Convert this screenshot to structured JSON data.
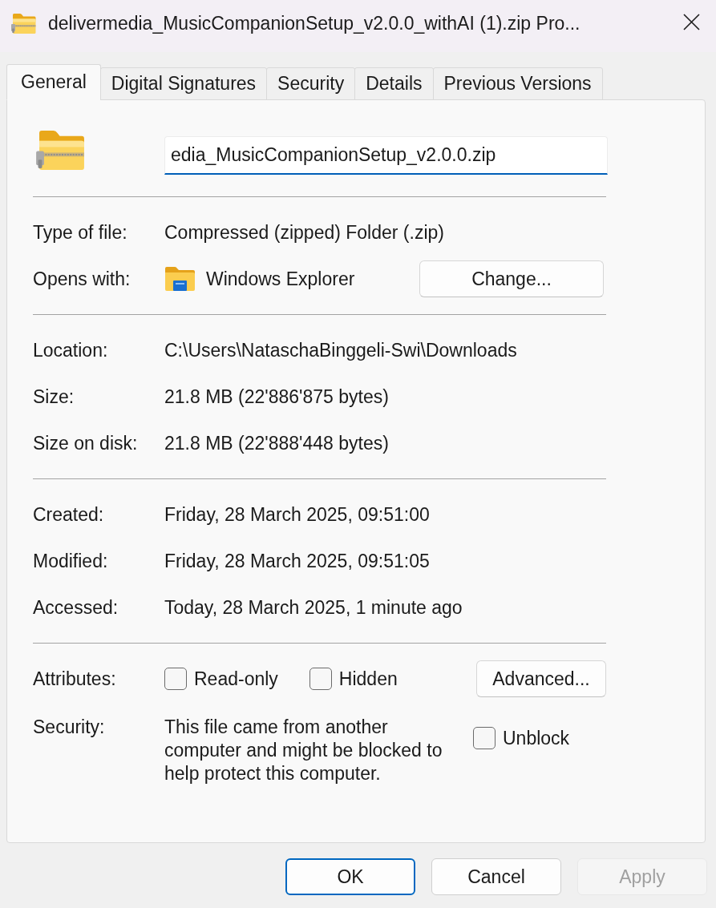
{
  "window": {
    "title": "delivermedia_MusicCompanionSetup_v2.0.0_withAI (1).zip Pro..."
  },
  "tabs": [
    {
      "label": "General",
      "selected": true
    },
    {
      "label": "Digital Signatures",
      "selected": false
    },
    {
      "label": "Security",
      "selected": false
    },
    {
      "label": "Details",
      "selected": false
    },
    {
      "label": "Previous Versions",
      "selected": false
    }
  ],
  "header": {
    "name_field": {
      "value": "edia_MusicCompanionSetup_v2.0.0.zip",
      "focused": true
    }
  },
  "sections": [
    {
      "rows": [
        {
          "kind": "text",
          "label": "Type of file:",
          "value": "Compressed (zipped) Folder (.zip)"
        },
        {
          "kind": "app",
          "label": "Opens with:",
          "value": "Windows Explorer",
          "button": "Change..."
        }
      ]
    },
    {
      "rows": [
        {
          "kind": "text",
          "label": "Location:",
          "value": "C:\\Users\\NataschaBinggeli-Swi\\Downloads"
        },
        {
          "kind": "text",
          "label": "Size:",
          "value": "21.8 MB (22'886'875 bytes)"
        },
        {
          "kind": "text",
          "label": "Size on disk:",
          "value": "21.8 MB (22'888'448 bytes)"
        }
      ]
    },
    {
      "rows": [
        {
          "kind": "text",
          "label": "Created:",
          "value": "Friday, 28 March 2025, 09:51:00"
        },
        {
          "kind": "text",
          "label": "Modified:",
          "value": "Friday, 28 March 2025, 09:51:05"
        },
        {
          "kind": "text",
          "label": "Accessed:",
          "value": "Today, 28 March 2025, 1 minute ago"
        }
      ]
    },
    {
      "rows": [
        {
          "kind": "attributes",
          "label": "Attributes:",
          "checkboxes": [
            {
              "label": "Read-only",
              "checked": false
            },
            {
              "label": "Hidden",
              "checked": false
            }
          ],
          "button": "Advanced..."
        },
        {
          "kind": "security",
          "label": "Security:",
          "value": "This file came from another computer and might be blocked to help protect this computer.",
          "checkbox": {
            "label": "Unblock",
            "checked": false
          }
        }
      ]
    }
  ],
  "buttons": [
    {
      "label": "OK",
      "default": true,
      "disabled": false
    },
    {
      "label": "Cancel",
      "default": false,
      "disabled": false
    },
    {
      "label": "Apply",
      "default": false,
      "disabled": true
    }
  ]
}
